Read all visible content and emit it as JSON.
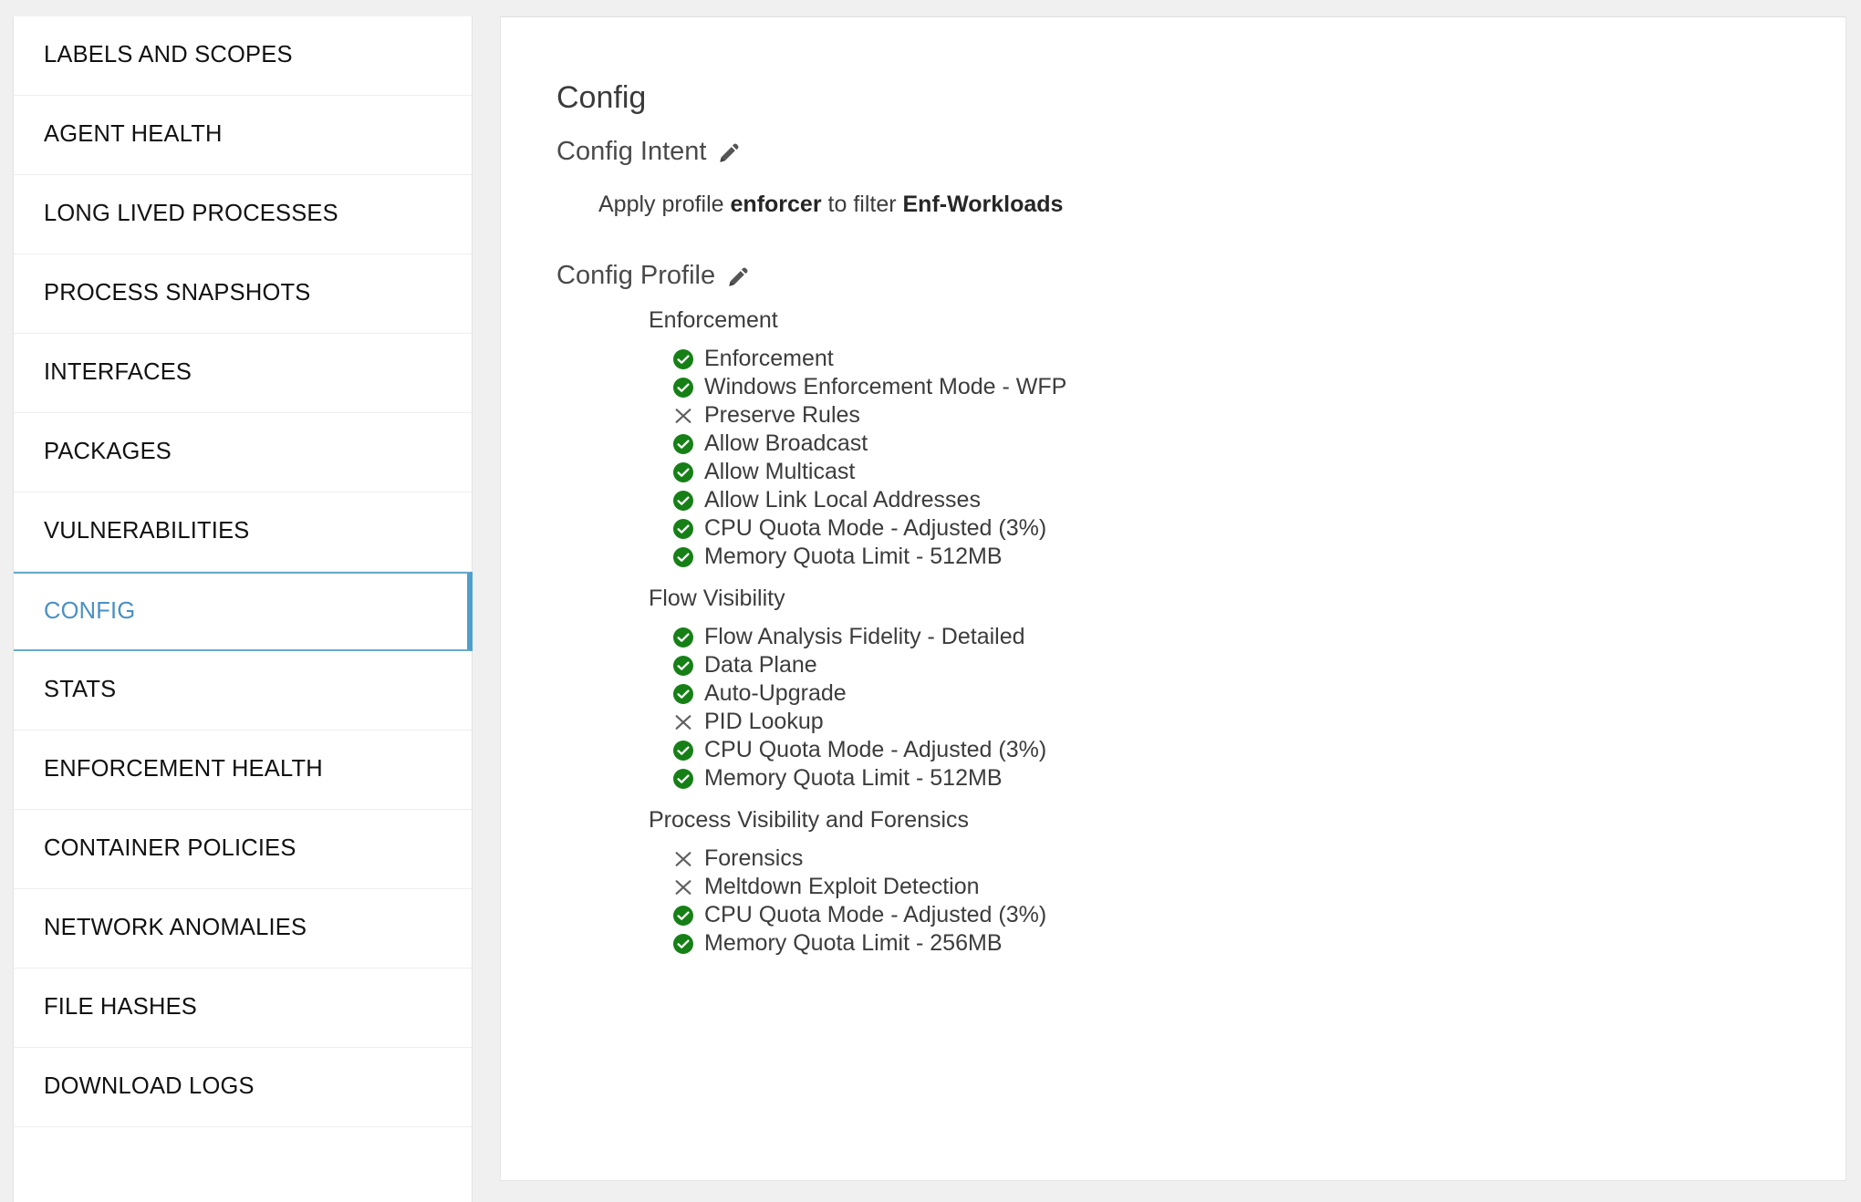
{
  "sidebar": {
    "items": [
      {
        "label": "LABELS AND SCOPES",
        "active": false,
        "name": "labels-and-scopes"
      },
      {
        "label": "AGENT HEALTH",
        "active": false,
        "name": "agent-health"
      },
      {
        "label": "LONG LIVED PROCESSES",
        "active": false,
        "name": "long-lived-processes"
      },
      {
        "label": "PROCESS SNAPSHOTS",
        "active": false,
        "name": "process-snapshots"
      },
      {
        "label": "INTERFACES",
        "active": false,
        "name": "interfaces"
      },
      {
        "label": "PACKAGES",
        "active": false,
        "name": "packages"
      },
      {
        "label": "VULNERABILITIES",
        "active": false,
        "name": "vulnerabilities"
      },
      {
        "label": "CONFIG",
        "active": true,
        "name": "config"
      },
      {
        "label": "STATS",
        "active": false,
        "name": "stats"
      },
      {
        "label": "ENFORCEMENT HEALTH",
        "active": false,
        "name": "enforcement-health"
      },
      {
        "label": "CONTAINER POLICIES",
        "active": false,
        "name": "container-policies"
      },
      {
        "label": "NETWORK ANOMALIES",
        "active": false,
        "name": "network-anomalies"
      },
      {
        "label": "FILE HASHES",
        "active": false,
        "name": "file-hashes"
      },
      {
        "label": "DOWNLOAD LOGS",
        "active": false,
        "name": "download-logs"
      },
      {
        "label": "",
        "active": false,
        "name": "blank-row"
      }
    ]
  },
  "main": {
    "title": "Config",
    "config_intent": {
      "heading": "Config Intent",
      "edit_icon": "pencil-icon",
      "statement_prefix": "Apply profile ",
      "profile_name": "enforcer",
      "statement_middle": " to filter ",
      "filter_name": "Enf-Workloads"
    },
    "config_profile": {
      "heading": "Config Profile",
      "edit_icon": "pencil-icon",
      "groups": [
        {
          "title": "Enforcement",
          "features": [
            {
              "label": "Enforcement",
              "status": "enabled"
            },
            {
              "label": "Windows Enforcement Mode - WFP",
              "status": "enabled"
            },
            {
              "label": "Preserve Rules",
              "status": "disabled"
            },
            {
              "label": "Allow Broadcast",
              "status": "enabled"
            },
            {
              "label": "Allow Multicast",
              "status": "enabled"
            },
            {
              "label": "Allow Link Local Addresses",
              "status": "enabled"
            },
            {
              "label": "CPU Quota Mode - Adjusted (3%)",
              "status": "enabled"
            },
            {
              "label": "Memory Quota Limit - 512MB",
              "status": "enabled"
            }
          ]
        },
        {
          "title": "Flow Visibility",
          "features": [
            {
              "label": "Flow Analysis Fidelity - Detailed",
              "status": "enabled"
            },
            {
              "label": "Data Plane",
              "status": "enabled"
            },
            {
              "label": "Auto-Upgrade",
              "status": "enabled"
            },
            {
              "label": "PID Lookup",
              "status": "disabled"
            },
            {
              "label": "CPU Quota Mode - Adjusted (3%)",
              "status": "enabled"
            },
            {
              "label": "Memory Quota Limit - 512MB",
              "status": "enabled"
            }
          ]
        },
        {
          "title": "Process Visibility and Forensics",
          "features": [
            {
              "label": "Forensics",
              "status": "disabled"
            },
            {
              "label": "Meltdown Exploit Detection",
              "status": "disabled"
            },
            {
              "label": "CPU Quota Mode - Adjusted (3%)",
              "status": "enabled"
            },
            {
              "label": "Memory Quota Limit - 256MB",
              "status": "enabled"
            }
          ]
        }
      ]
    }
  },
  "colors": {
    "enabled_green": "#168016",
    "disabled_gray": "#5f5f5f",
    "active_blue": "#4a90c4",
    "active_border": "#4f9fce",
    "page_background": "#f0f0f0",
    "panel_background": "#ffffff"
  },
  "icons": {
    "enabled": "check-circle-icon",
    "disabled": "cross-icon",
    "edit": "pencil-icon"
  }
}
